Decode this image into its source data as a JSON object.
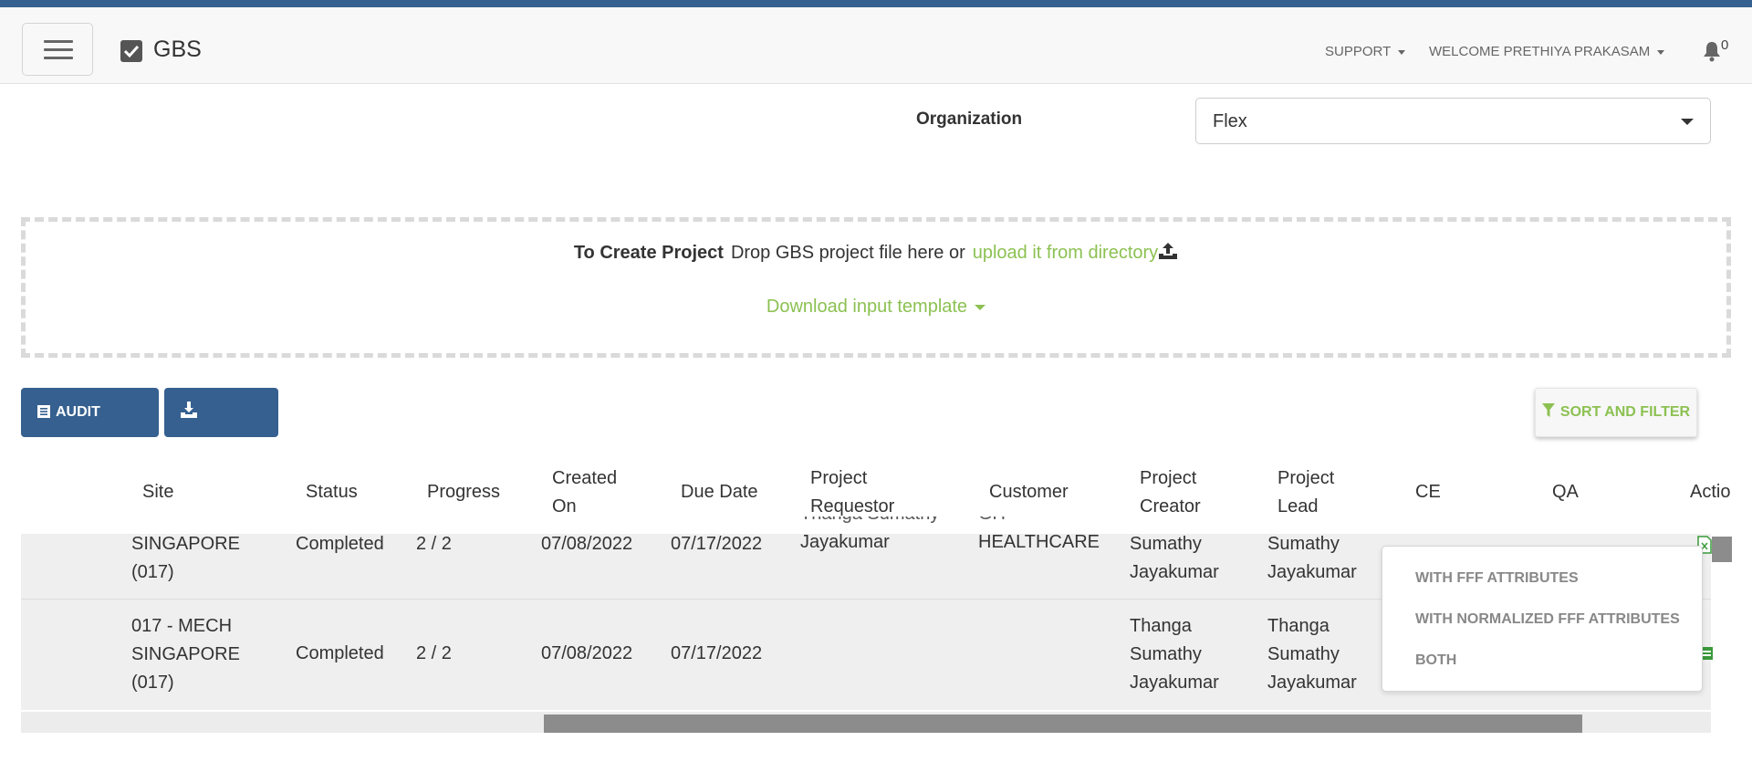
{
  "app": {
    "brand": "GBS"
  },
  "nav": {
    "support_label": "SUPPORT",
    "welcome_label": "WELCOME PRETHIYA PRAKASAM",
    "notification_count": "0"
  },
  "org": {
    "label": "Organization",
    "value": "Flex"
  },
  "dropzone": {
    "heading": "To Create Project",
    "text": "Drop GBS project file here or",
    "upload_link": "upload it from directory",
    "download_template": "Download input template"
  },
  "toolbar": {
    "audit_trail_label": "AUDIT TRAIL",
    "export_label": "EXPORT",
    "sort_filter_label": "SORT AND FILTER"
  },
  "export_menu": {
    "items": [
      "WITH FFF ATTRIBUTES",
      "WITH NORMALIZED FFF ATTRIBUTES",
      "BOTH"
    ]
  },
  "table": {
    "headers": {
      "site": "Site",
      "status": "Status",
      "progress": "Progress",
      "created_on_1": "Created",
      "created_on_2": "On",
      "due_date": "Due Date",
      "requestor_1": "Project",
      "requestor_2": "Requestor",
      "customer": "Customer",
      "creator_1": "Project",
      "creator_2": "Creator",
      "lead_1": "Project",
      "lead_2": "Lead",
      "ce": "CE",
      "qa": "QA",
      "action": "Actio"
    },
    "rows": [
      {
        "site_1": "SINGAPORE",
        "site_2": "(017)",
        "status": "Completed",
        "progress": "2 / 2",
        "created_on": "07/08/2022",
        "due_date": "07/17/2022",
        "requestor_clipped": "Thanga Sumathy",
        "requestor_2": "Jayakumar",
        "customer_clipped": "GH",
        "customer": "HEALTHCARE",
        "creator_1": "Sumathy",
        "creator_2": "Jayakumar",
        "lead_1": "Sumathy",
        "lead_2": "Jayakumar"
      },
      {
        "site_1": "017 - MECH",
        "site_2": "SINGAPORE",
        "site_3": "(017)",
        "status": "Completed",
        "progress": "2 / 2",
        "created_on": "07/08/2022",
        "due_date": "07/17/2022",
        "creator_1": "Thanga",
        "creator_2": "Sumathy",
        "creator_3": "Jayakumar",
        "lead_1": "Thanga",
        "lead_2": "Sumathy",
        "lead_3": "Jayakumar"
      }
    ]
  },
  "icons": [
    "menu-icon",
    "check-square-icon",
    "bell-icon",
    "upload-icon",
    "list-icon",
    "download-icon",
    "filter-icon",
    "excel-file-icon"
  ],
  "colors": {
    "accent_blue": "#35608f",
    "accent_green": "#8cc152"
  }
}
